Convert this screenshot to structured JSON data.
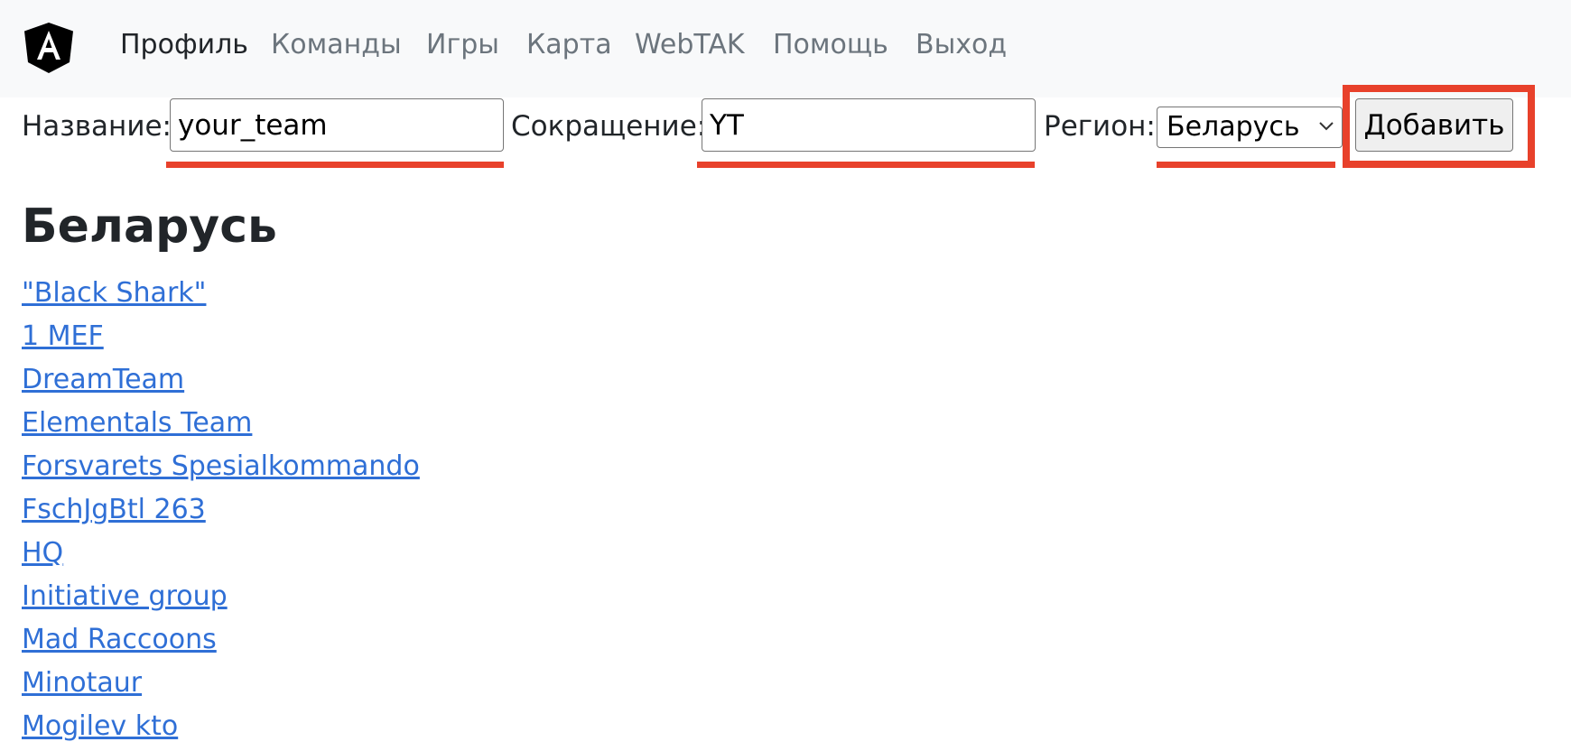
{
  "nav": {
    "items": [
      {
        "label": "Профиль",
        "active": true
      },
      {
        "label": "Команды",
        "active": false
      },
      {
        "label": "Игры",
        "active": false
      },
      {
        "label": "Карта",
        "active": false
      },
      {
        "label": "WebTAK",
        "active": false
      },
      {
        "label": "Помощь",
        "active": false
      },
      {
        "label": "Выход",
        "active": false
      }
    ]
  },
  "form": {
    "name_label": "Название:",
    "name_value": "your_team",
    "abbr_label": "Сокращение:",
    "abbr_value": "YT",
    "region_label": "Регион:",
    "region_value": "Беларусь",
    "add_label": "Добавить"
  },
  "region_heading": "Беларусь",
  "teams": [
    "\"Black Shark\"",
    "1 MEF",
    "DreamTeam",
    "Elementals Team",
    "Forsvarets Spesialkommando",
    "FschJgBtl 263",
    "HQ",
    "Initiative group",
    "Mad Raccoons",
    "Minotaur",
    "Mogilev kto"
  ],
  "colors": {
    "accent_annotation": "#e8412b",
    "link": "#2f6fd6",
    "navbar_bg": "#f8f9fa"
  }
}
